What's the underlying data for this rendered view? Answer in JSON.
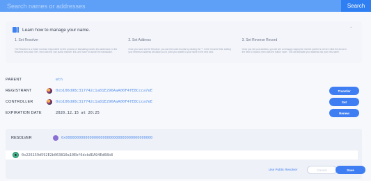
{
  "search": {
    "placeholder": "Search names or addresses",
    "button_label": "Search"
  },
  "learn": {
    "title": "Learn how to manage your name.",
    "steps": [
      {
        "title": "1. Set Resolver",
        "body": "The Resolver is a Smart Contract responsible for the process of translating names into addresses. In the Resolver area click 'Set', then click the 'use public resolver' link, and 'save' to launch the transaction."
      },
      {
        "title": "2. Set Address",
        "body": "Once you have set the Resolver, you can then add records by clicking the '+' in the 'records' field. Adding your ethereum address will allow you to point your wallet to your name in the next click."
      },
      {
        "title": "3. Set Reverse Record",
        "body": "Once you set your address, you will see a message saying the reverse pointer is not set. Click the arrow in the field to expand, then click the button 'save'. This will translate your address into your new name."
      }
    ]
  },
  "details": {
    "parent": {
      "label": "PARENT",
      "value": "eth"
    },
    "registrant": {
      "label": "REGISTRANT",
      "value": "0xb106d98c317742c1a81E296AaA00F4fE8Ccca7eE",
      "button": "Transfer"
    },
    "controller": {
      "label": "CONTROLLER",
      "value": "0xb106d98c317742c1a81E296AaA00F4fE8Ccca7eE",
      "button": "Set"
    },
    "expiration": {
      "label": "EXPIRATION DATE",
      "value": "2020.12.15 at 20:25",
      "button": "Renew"
    }
  },
  "resolver": {
    "label": "RESOLVER",
    "value": "0x0000000000000000000000000000000000000000",
    "input_value": "0x226159d592E2b063810a10Ebf6dcbADA94Ed68b8",
    "use_public_label": "Use Public Resolver",
    "cancel_label": "Cancel",
    "save_label": "Save"
  }
}
